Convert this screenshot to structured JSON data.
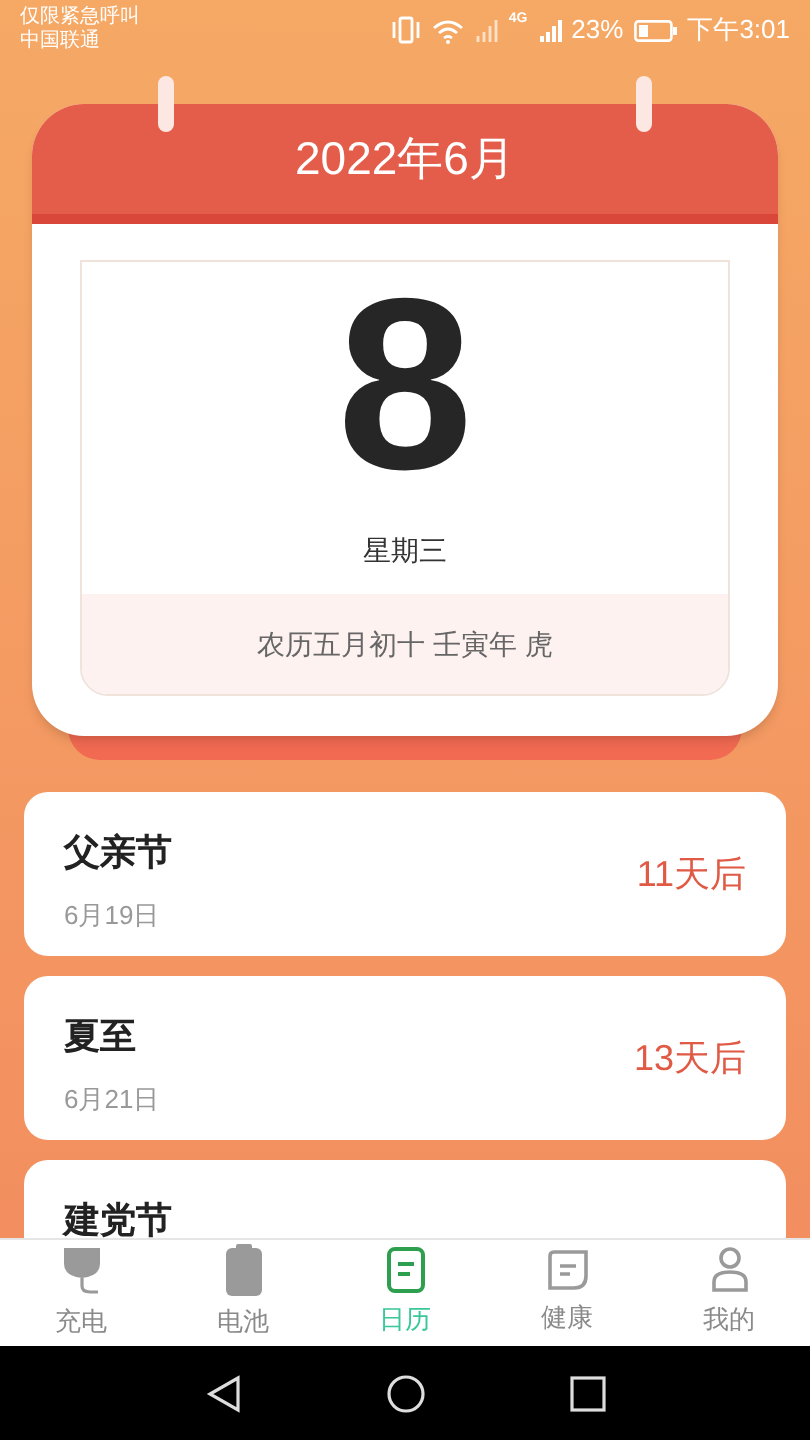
{
  "status_bar": {
    "notice": "仅限紧急呼叫",
    "carrier": "中国联通",
    "network": "4G",
    "battery": "23%",
    "time": "下午3:01"
  },
  "calendar": {
    "month": "2022年6月",
    "day": "8",
    "weekday": "星期三",
    "lunar": "农历五月初十 壬寅年 虎"
  },
  "events": [
    {
      "name": "父亲节",
      "date": "6月19日",
      "countdown": "11天后"
    },
    {
      "name": "夏至",
      "date": "6月21日",
      "countdown": "13天后"
    },
    {
      "name": "建党节"
    }
  ],
  "tabs": [
    {
      "kind": "charge",
      "label": "充电",
      "selected": false
    },
    {
      "kind": "battery",
      "label": "电池",
      "selected": false
    },
    {
      "kind": "calendar",
      "label": "日历",
      "selected": true
    },
    {
      "kind": "health",
      "label": "健康",
      "selected": false
    },
    {
      "kind": "profile",
      "label": "我的",
      "selected": false
    }
  ]
}
